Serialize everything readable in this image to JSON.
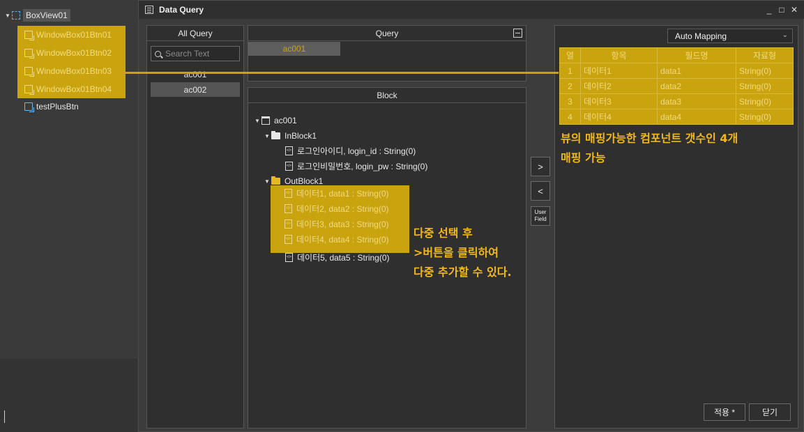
{
  "outline": {
    "root_label": "BoxView01",
    "highlighted_items": [
      "WindowBox01Btn01",
      "WindowBox01Btn02",
      "WindowBox01Btn03",
      "WindowBox01Btn04"
    ],
    "other_item": "testPlusBtn"
  },
  "dialog": {
    "title": "Data Query",
    "controls": {
      "minimize": "_",
      "maximize": "□",
      "close": "✕"
    }
  },
  "all_query": {
    "header": "All Query",
    "search_placeholder": "Search Text",
    "items": [
      "ac001",
      "ac002"
    ],
    "selected": "ac002"
  },
  "query": {
    "header": "Query",
    "tab": "ac001"
  },
  "block": {
    "header": "Block",
    "root": "ac001",
    "in_block": {
      "label": "InBlock1",
      "fields": [
        "로그인아이디, login_id : String(0)",
        "로그인비밀번호, login_pw : String(0)"
      ]
    },
    "out_block": {
      "label": "OutBlock1",
      "selected_fields": [
        "데이터1, data1 : String(0)",
        "데이터2, data2 : String(0)",
        "데이터3, data3 : String(0)",
        "데이터4, data4 : String(0)"
      ],
      "other_field": "데이터5, data5 : String(0)"
    },
    "annotation": [
      "다중 선택 후",
      ">버튼을 클릭하여",
      "다중 추가할 수 있다."
    ]
  },
  "middle_buttons": {
    "add": ">",
    "remove": "<",
    "user_field_line1": "User",
    "user_field_line2": "Field"
  },
  "mapping": {
    "mode": "Auto Mapping",
    "columns": [
      "열",
      "항목",
      "필드명",
      "자료형"
    ],
    "rows": [
      [
        "1",
        "데이터1",
        "data1",
        "String(0)"
      ],
      [
        "2",
        "데이터2",
        "data2",
        "String(0)"
      ],
      [
        "3",
        "데이터3",
        "data3",
        "String(0)"
      ],
      [
        "4",
        "데이터4",
        "data4",
        "String(0)"
      ]
    ],
    "annotation": [
      "뷰의 매핑가능한 컴포넌트 갯수인 4개",
      "매핑 가능"
    ],
    "apply_label": "적용 *",
    "close_label": "닫기"
  },
  "colors": {
    "highlight": "#c9a40f",
    "annotation_text": "#f0b81c",
    "background": "#3a3a3a",
    "panel": "#2f2f2f"
  }
}
